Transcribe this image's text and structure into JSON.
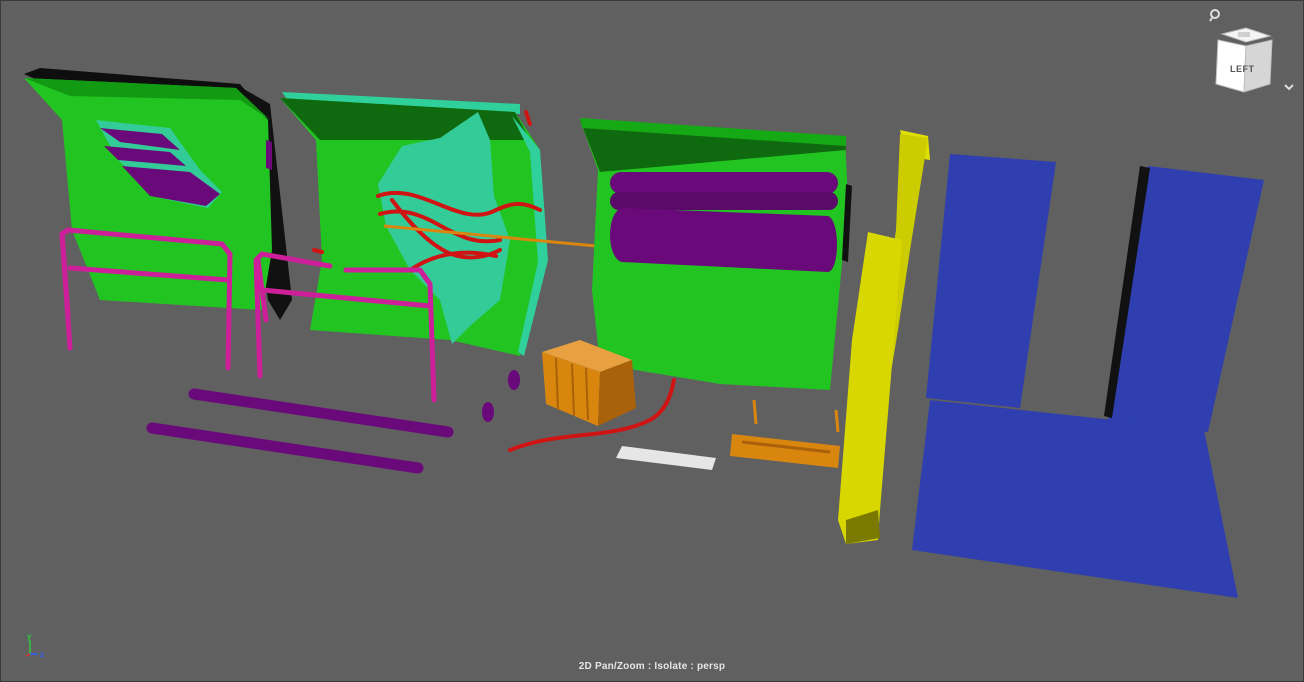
{
  "viewcube": {
    "face_label": "LEFT"
  },
  "status": {
    "text": "2D Pan/Zoom : Isolate : persp"
  },
  "axis": {
    "y": "y",
    "z": "z"
  },
  "colors": {
    "background": "#606060",
    "panel_green": "#22c422",
    "panel_dark_green": "#0f6a0f",
    "teal": "#33cc99",
    "purple": "#6a0a7a",
    "magenta": "#cc1f99",
    "red": "#d01414",
    "orange": "#d9860f",
    "yellow": "#d8d800",
    "blue": "#2f3fb0",
    "white": "#e6e6e6"
  }
}
